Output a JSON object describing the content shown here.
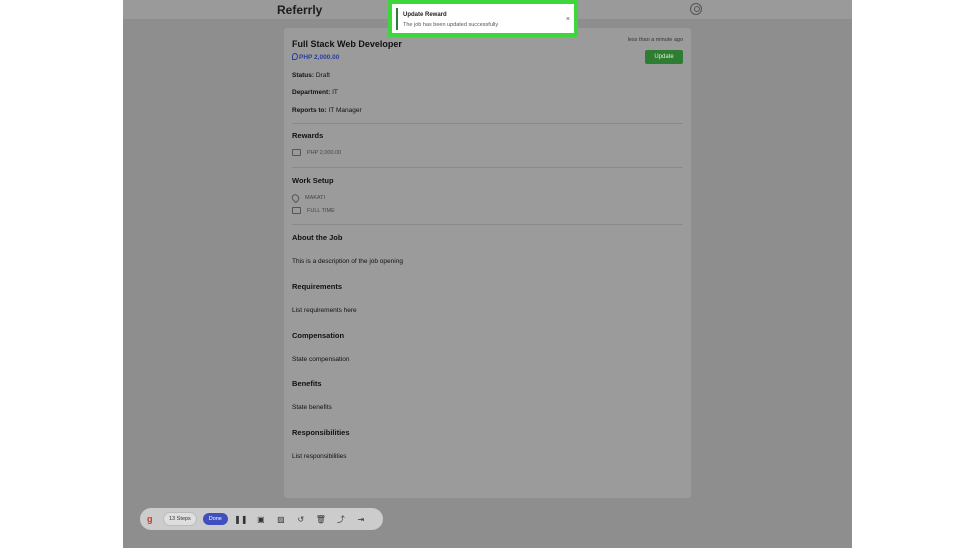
{
  "app": {
    "brand": "Referrly"
  },
  "job": {
    "title": "Full Stack Web Developer",
    "price": "PHP 2,000.00",
    "timestamp": "less than a minute ago",
    "update_label": "Update",
    "status_label": "Status:",
    "status_value": "Draft",
    "department_label": "Department:",
    "department_value": "IT",
    "reports_label": "Reports to:",
    "reports_value": "IT Manager"
  },
  "rewards": {
    "title": "Rewards",
    "amount": "PHP 2,000.00",
    "icon": "money-icon"
  },
  "work_setup": {
    "title": "Work Setup",
    "location": "MAKATI",
    "type": "FULL TIME"
  },
  "sections": {
    "about_title": "About the Job",
    "about_text": "This is a description of the job opening",
    "requirements_title": "Requirements",
    "requirements_text": "List requirements here",
    "compensation_title": "Compensation",
    "compensation_text": "State compensation",
    "benefits_title": "Benefits",
    "benefits_text": "State benefits",
    "responsibilities_title": "Responsibilities",
    "responsibilities_text": "List responsibilities"
  },
  "toast": {
    "title": "Update Reward",
    "message": "The job has been updated successfully",
    "close": "×"
  },
  "recorder": {
    "logo": "g",
    "steps": "13 Steps",
    "done": "Done",
    "icons": [
      "pause-icon",
      "stop-icon",
      "image-icon",
      "undo-icon",
      "trash-icon",
      "share-icon",
      "skip-icon"
    ]
  },
  "colors": {
    "accent": "#3dd63d",
    "update_button": "#2e7d32",
    "done_button": "#3f4fbf",
    "price": "#2a3e9e"
  }
}
